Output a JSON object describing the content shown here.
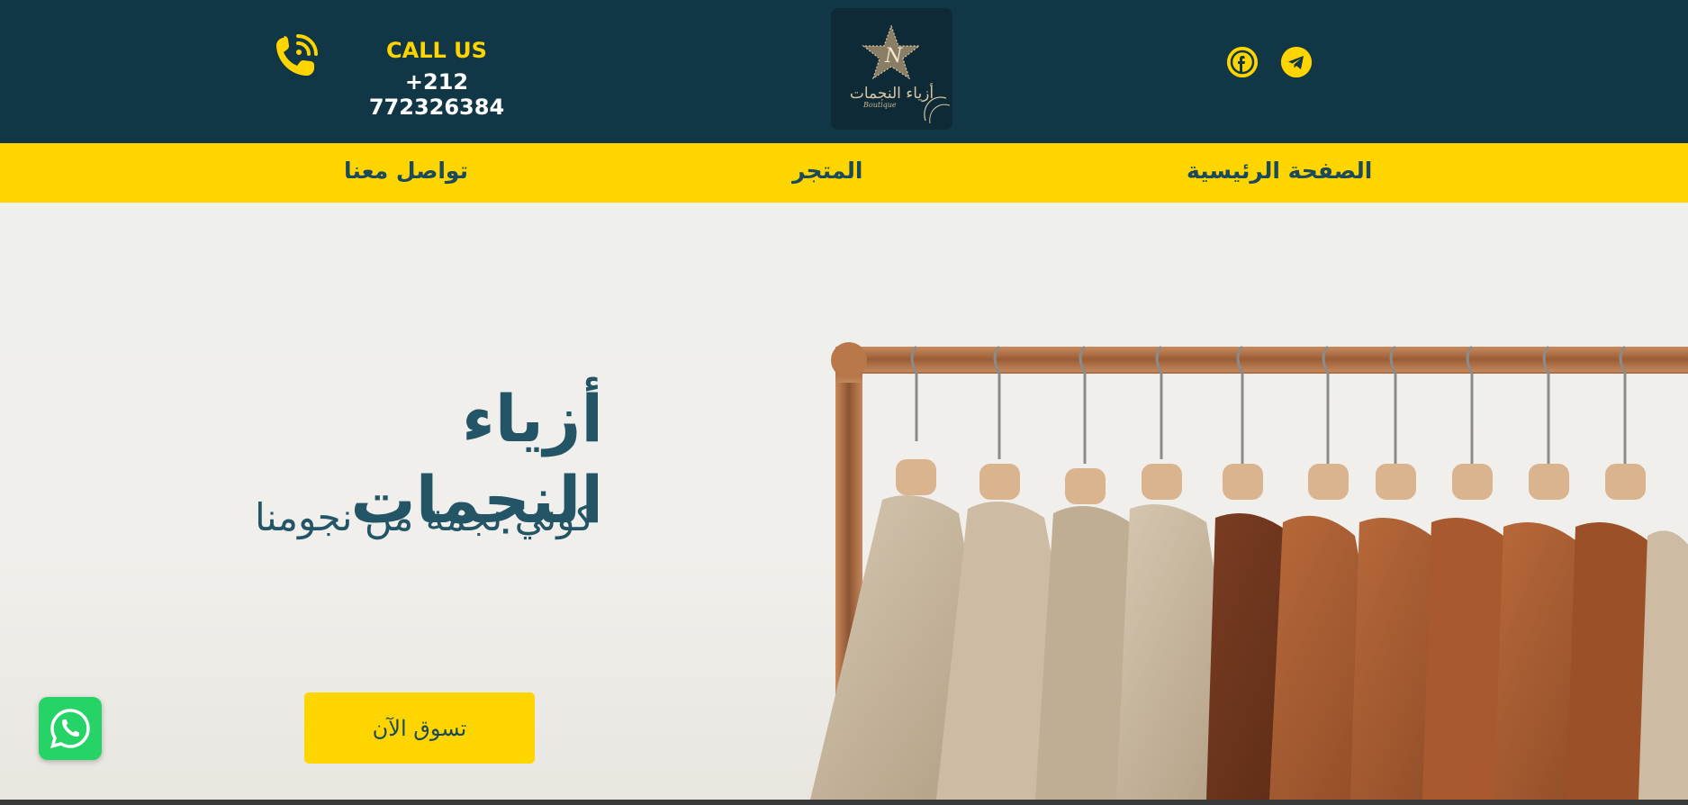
{
  "header": {
    "call_label": "CALL US",
    "phone_number": "+212 772326384",
    "logo_text": "أزياء النجمات",
    "background_color": "#113746",
    "accent_color": "#FFD500",
    "icons": {
      "phone": "phone-ringing-icon",
      "facebook": "facebook-icon",
      "telegram": "telegram-icon"
    }
  },
  "nav": {
    "items": [
      {
        "label": "الصفحة الرئيسية"
      },
      {
        "label": "المتجر"
      },
      {
        "label": "تواصل معنا"
      }
    ],
    "background_color": "#FFD500",
    "text_color": "#1c4a5b"
  },
  "hero": {
    "title": "أزياء النجمات",
    "subtitle": "كوني نجمة من نجومنا",
    "cta_label": "تسوق الآن",
    "text_color": "#235566"
  },
  "floating": {
    "whatsapp_icon": "whatsapp-icon",
    "whatsapp_color": "#25D366"
  }
}
